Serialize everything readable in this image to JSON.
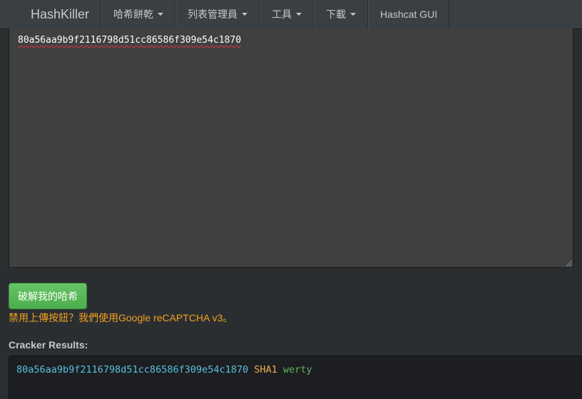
{
  "navbar": {
    "brand": "HashKiller",
    "items": [
      {
        "label": "哈希餅乾",
        "dropdown": true
      },
      {
        "label": "列表管理員",
        "dropdown": true
      },
      {
        "label": "工具",
        "dropdown": true
      },
      {
        "label": "下載",
        "dropdown": true
      },
      {
        "label": "Hashcat GUI",
        "dropdown": false
      }
    ]
  },
  "input": {
    "value": "80a56aa9b9f2116798d51cc86586f309e54c1870"
  },
  "crack_button": {
    "label": "破解我的哈希"
  },
  "notice": "禁用上傳按鈕？我們使用Google reCAPTCHA v3。",
  "results": {
    "label": "Cracker Results:",
    "rows": [
      {
        "hash": "80a56aa9b9f2116798d51cc86586f309e54c1870",
        "type": "SHA1",
        "plaintext": "werty"
      }
    ]
  },
  "colors": {
    "navbar_bg": "#3a3f44",
    "page_bg": "#2b2e31",
    "button_green": "#5cb85c",
    "notice_orange": "#f0a020",
    "hash_cyan": "#5bc0de",
    "type_orange": "#f0ad4e",
    "plain_green": "#5cb85c"
  }
}
